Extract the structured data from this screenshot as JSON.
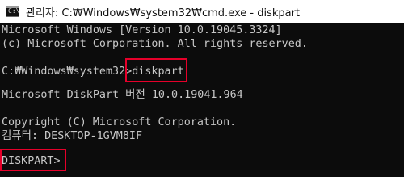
{
  "window": {
    "title": "관리자: C:₩Windows₩system32₩cmd.exe - diskpart",
    "icon": "cmd-icon",
    "icon_glyph": "C:\\"
  },
  "colors": {
    "console_bg": "#0c0c0c",
    "console_text": "#c7c7c7",
    "highlight": "#e6002a"
  },
  "console": {
    "line1": "Microsoft Windows [Version 10.0.19045.3324]",
    "line2": "(c) Microsoft Corporation. All rights reserved.",
    "prompt_path": "C:₩Windows₩system32>",
    "command": "diskpart",
    "line4": "Microsoft DiskPart 버전 10.0.19041.964",
    "line5": "Copyright (C) Microsoft Corporation.",
    "line6": "컴퓨터: DESKTOP-1GVM8IF",
    "diskpart_prompt": "DISKPART>"
  }
}
